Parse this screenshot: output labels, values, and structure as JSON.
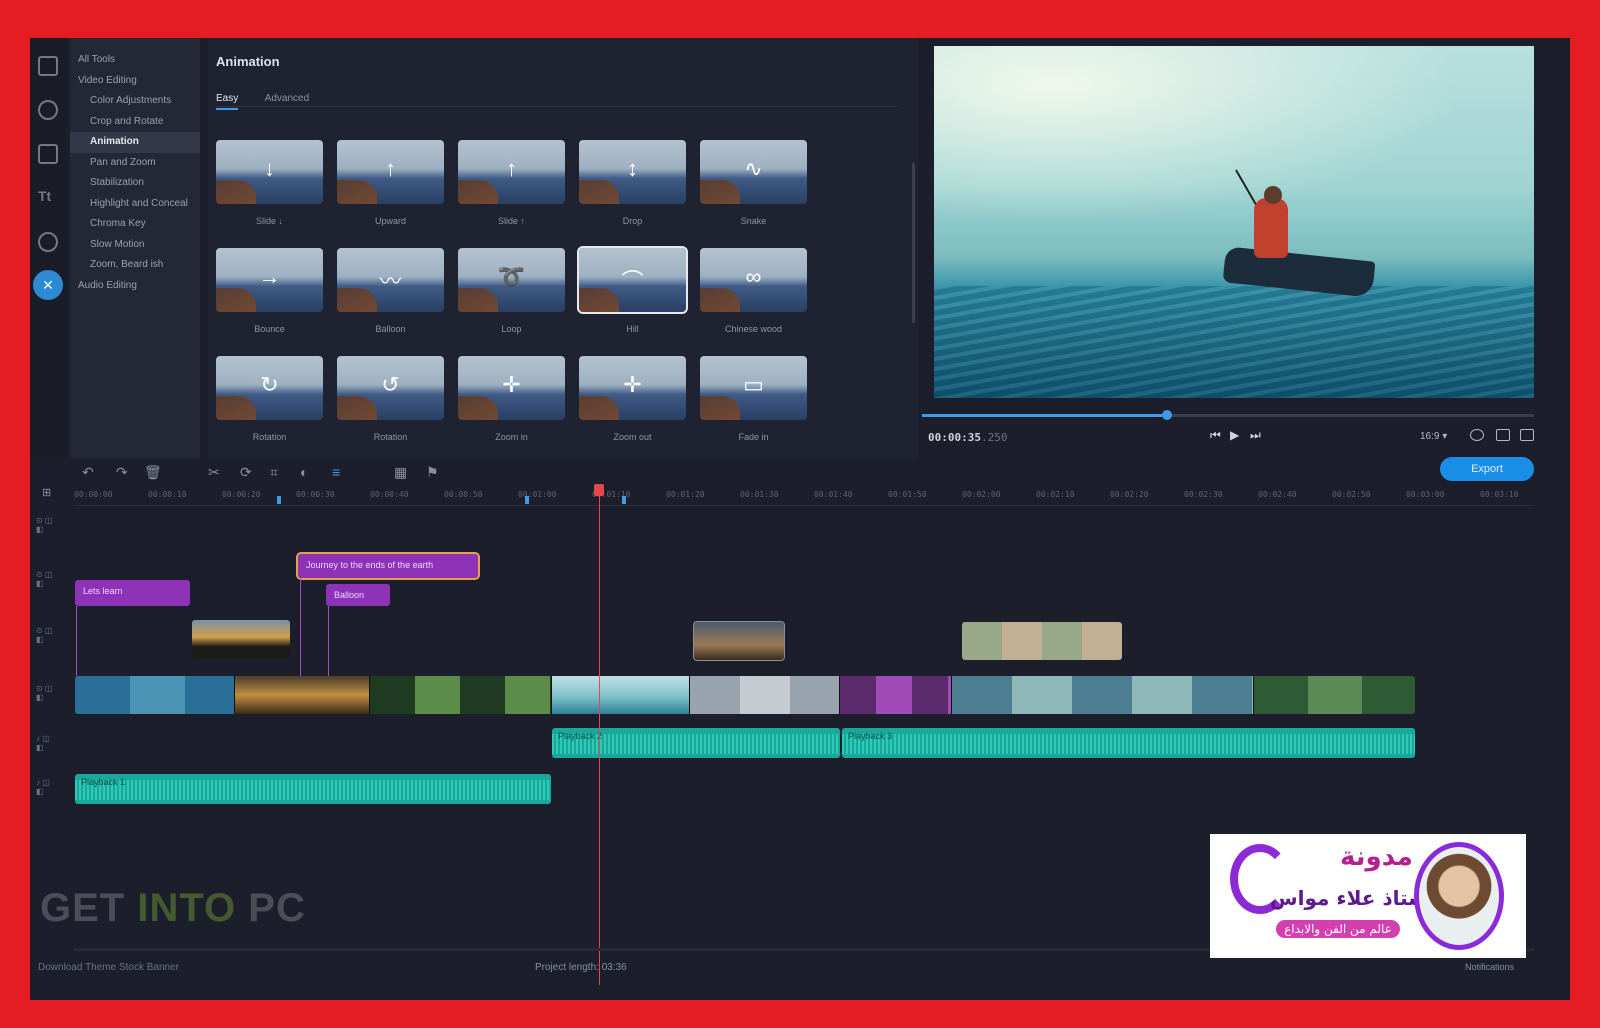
{
  "rail": {
    "icons": [
      "import-icon",
      "magic-wand-icon",
      "transitions-icon",
      "titles-icon",
      "stickers-icon",
      "more-tools-icon"
    ]
  },
  "tree": {
    "items": [
      {
        "label": "All Tools",
        "level": 0
      },
      {
        "label": "Video Editing",
        "level": 0
      },
      {
        "label": "Color Adjustments",
        "level": 1
      },
      {
        "label": "Crop and Rotate",
        "level": 1
      },
      {
        "label": "Animation",
        "level": 1,
        "active": true
      },
      {
        "label": "Pan and Zoom",
        "level": 1
      },
      {
        "label": "Stabilization",
        "level": 1
      },
      {
        "label": "Highlight and Conceal",
        "level": 1
      },
      {
        "label": "Chroma Key",
        "level": 1
      },
      {
        "label": "Slow Motion",
        "level": 1
      },
      {
        "label": "Zoom, Beard ish",
        "level": 1
      },
      {
        "label": "Audio Editing",
        "level": 0
      }
    ]
  },
  "animation": {
    "title": "Animation",
    "tabs": [
      "Easy",
      "Advanced"
    ],
    "presets": [
      "Slide ↓",
      "Upward",
      "Slide ↑",
      "Drop",
      "Snake",
      "Bounce",
      "Balloon",
      "Loop",
      "Hill",
      "Chinese wood",
      "Rotation",
      "Rotation",
      "Zoom in",
      "Zoom out",
      "Fade in"
    ]
  },
  "preview": {
    "timecode": "00:00:35",
    "timecode_suffix": ".250",
    "position_pct": 40,
    "quality": "16:9 ▾",
    "controls": {
      "prev": "⏮",
      "play": "▶",
      "next": "⏭"
    }
  },
  "toolbar": {
    "export_label": "Export"
  },
  "ruler": {
    "ticks": [
      "00:00:00",
      "00:00:10",
      "00:00:20",
      "00:00:30",
      "00:00:40",
      "00:00:50",
      "00:01:00",
      "00:01:10",
      "00:01:20",
      "00:01:30",
      "00:01:40",
      "00:01:50",
      "00:02:00",
      "00:02:10",
      "00:02:20",
      "00:02:30",
      "00:02:40",
      "00:02:50",
      "00:03:00",
      "00:03:10"
    ]
  },
  "clips": {
    "title1": "Lets learn",
    "title2": "Journey to the ends of the earth",
    "title3": "Balloon",
    "audio1": "Playback 1",
    "audio2": "Playback 2",
    "audio3": "Playback 3"
  },
  "footer": {
    "left": "Download Theme Stock Banner",
    "mid": "Project length: 03:36",
    "right": "Notifications"
  },
  "watermark": {
    "part1": "GET ",
    "part2": "INTO",
    "part3": " PC"
  },
  "logo": {
    "title": "مدونة",
    "subtitle": "الاستاذ علاء مواس",
    "tagline": "عالم من الفن والابداع"
  }
}
